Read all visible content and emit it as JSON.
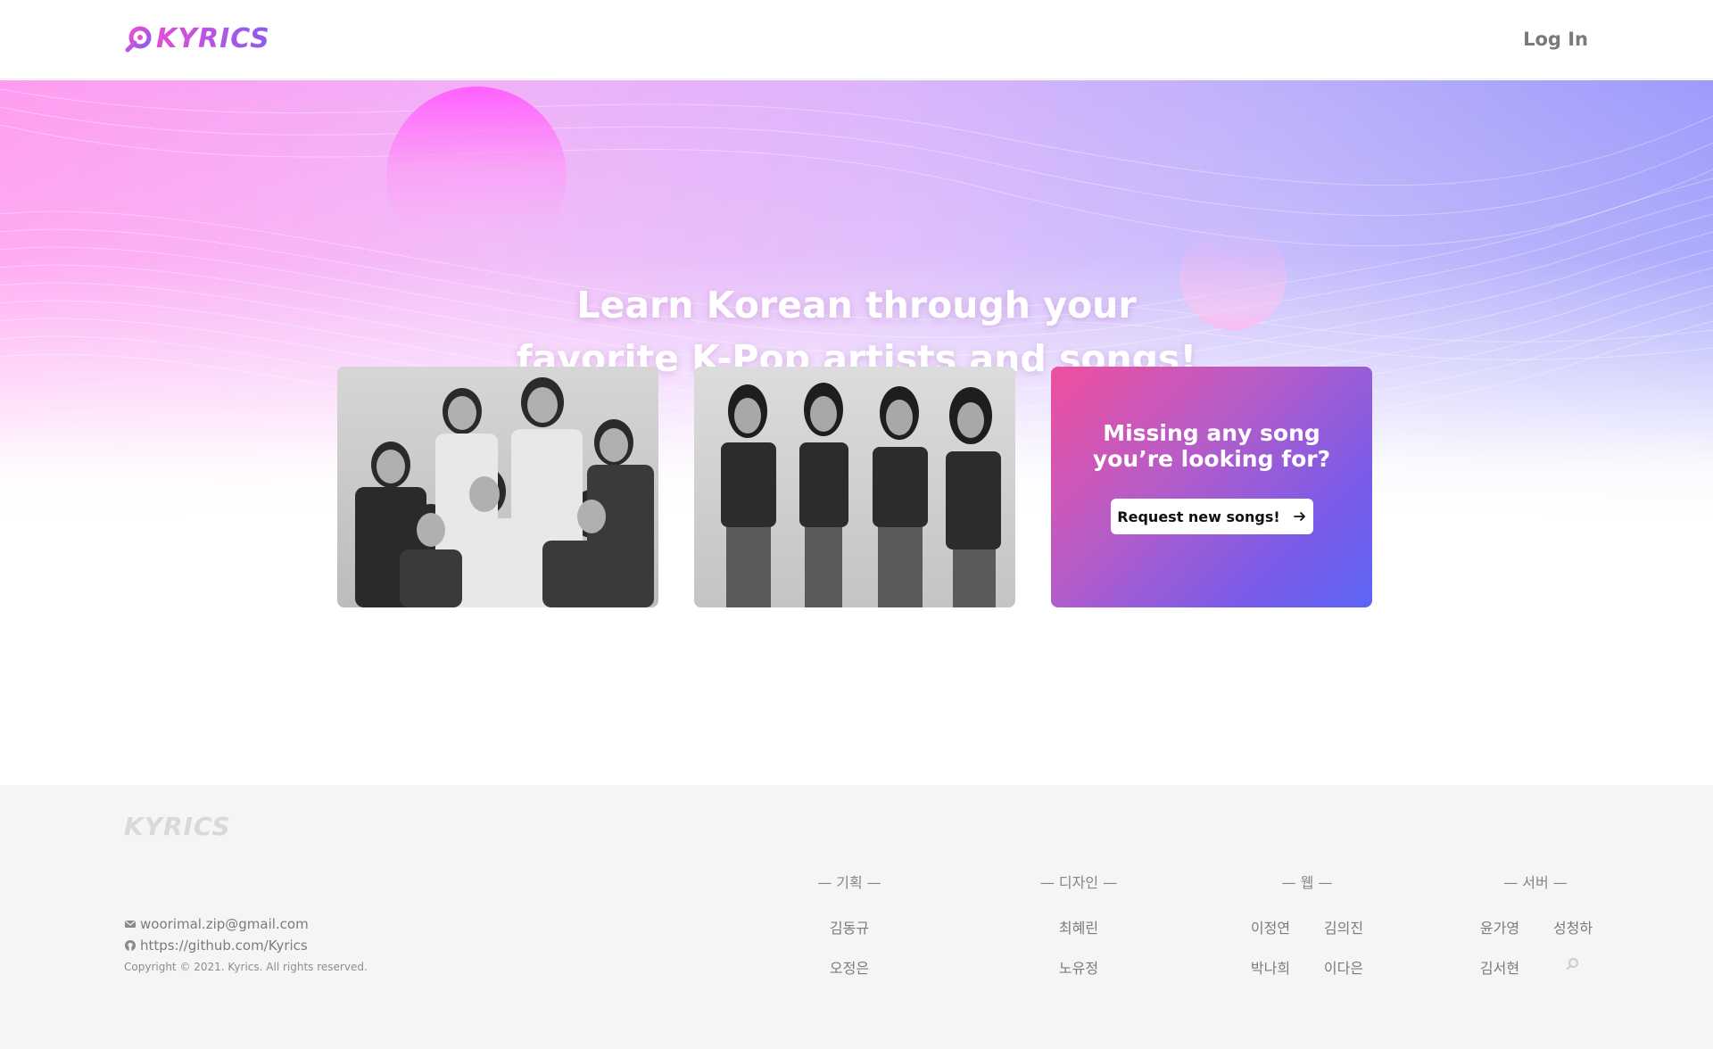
{
  "header": {
    "logo_text": "KYRICS",
    "login_label": "Log In"
  },
  "hero": {
    "headline_line1": "Learn Korean through your",
    "headline_line2": "favorite K-Pop artists and songs!"
  },
  "cards": {
    "request_title": "Missing any song\nyou’re looking for?",
    "request_button_label": "Request new songs!"
  },
  "footer": {
    "logo_text": "KYRICS",
    "email": "woorimal.zip@gmail.com",
    "github": "https://github.com/Kyrics",
    "copyright": "Copyright © 2021. Kyrics. All rights reserved.",
    "teams": {
      "planning": {
        "title": "— 기획 —",
        "members": [
          "김동규",
          "오정은"
        ]
      },
      "design": {
        "title": "— 디자인 —",
        "members": [
          "최혜린",
          "노유정"
        ]
      },
      "web": {
        "title": "— 웹 —",
        "members": [
          "이정연",
          "김의진",
          "박나희",
          "이다은"
        ]
      },
      "server": {
        "title": "— 서버 —",
        "members": [
          "윤가영",
          "성청하",
          "김서현"
        ]
      }
    }
  },
  "colors": {
    "brand_pink": "#e14fd6",
    "brand_purple": "#8a5cf0",
    "footer_bg": "#f5f5f5"
  }
}
